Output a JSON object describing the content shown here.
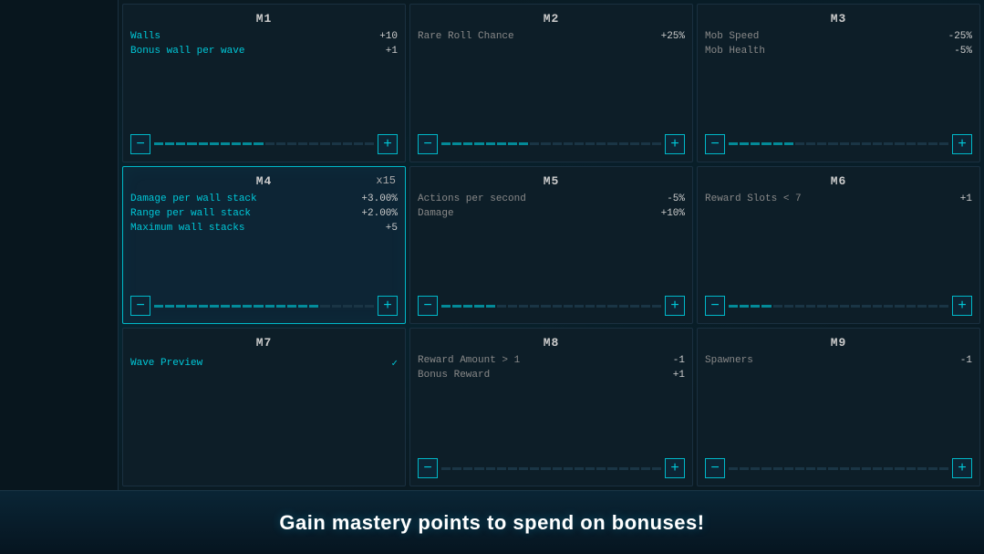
{
  "cards": [
    {
      "id": "m1",
      "title": "M1",
      "level": null,
      "selected": false,
      "stats": [
        {
          "label": "Walls",
          "value": "+10",
          "labelColor": "cyan"
        },
        {
          "label": "Bonus wall per wave",
          "value": "+1",
          "labelColor": "cyan"
        }
      ],
      "sliderFilled": 10,
      "sliderTotal": 20
    },
    {
      "id": "m2",
      "title": "M2",
      "level": null,
      "selected": false,
      "stats": [
        {
          "label": "Rare Roll Chance",
          "value": "+25%",
          "labelColor": "gray"
        }
      ],
      "sliderFilled": 8,
      "sliderTotal": 20
    },
    {
      "id": "m3",
      "title": "M3",
      "level": null,
      "selected": false,
      "stats": [
        {
          "label": "Mob Speed",
          "value": "-25%",
          "labelColor": "gray"
        },
        {
          "label": "Mob Health",
          "value": "-5%",
          "labelColor": "gray"
        }
      ],
      "sliderFilled": 6,
      "sliderTotal": 20
    },
    {
      "id": "m4",
      "title": "M4",
      "level": "x15",
      "selected": true,
      "stats": [
        {
          "label": "Damage per wall stack",
          "value": "+3.00%",
          "labelColor": "cyan"
        },
        {
          "label": "Range per wall stack",
          "value": "+2.00%",
          "labelColor": "cyan"
        },
        {
          "label": "Maximum wall stacks",
          "value": "+5",
          "labelColor": "cyan"
        }
      ],
      "sliderFilled": 15,
      "sliderTotal": 20
    },
    {
      "id": "m5",
      "title": "M5",
      "level": null,
      "selected": false,
      "stats": [
        {
          "label": "Actions per second",
          "value": "-5%",
          "labelColor": "gray"
        },
        {
          "label": "Damage",
          "value": "+10%",
          "labelColor": "gray"
        }
      ],
      "sliderFilled": 5,
      "sliderTotal": 20
    },
    {
      "id": "m6",
      "title": "M6",
      "level": null,
      "selected": false,
      "stats": [
        {
          "label": "Reward Slots < 7",
          "value": "+1",
          "labelColor": "gray"
        }
      ],
      "sliderFilled": 4,
      "sliderTotal": 20
    },
    {
      "id": "m7",
      "title": "M7",
      "level": null,
      "selected": false,
      "stats": [],
      "hasWavePreview": true,
      "sliderFilled": 0,
      "sliderTotal": 20
    },
    {
      "id": "m8",
      "title": "M8",
      "level": null,
      "selected": false,
      "stats": [
        {
          "label": "Reward Amount > 1",
          "value": "-1",
          "labelColor": "gray"
        },
        {
          "label": "Bonus Reward",
          "value": "+1",
          "labelColor": "gray"
        }
      ],
      "sliderFilled": 0,
      "sliderTotal": 20
    },
    {
      "id": "m9",
      "title": "M9",
      "level": null,
      "selected": false,
      "stats": [
        {
          "label": "Spawners",
          "value": "-1",
          "labelColor": "gray"
        }
      ],
      "sliderFilled": 0,
      "sliderTotal": 20
    }
  ],
  "footer": {
    "text": "Gain mastery points to spend on bonuses!"
  },
  "labels": {
    "wavePreview": "Wave Preview",
    "checkMark": "✓"
  }
}
